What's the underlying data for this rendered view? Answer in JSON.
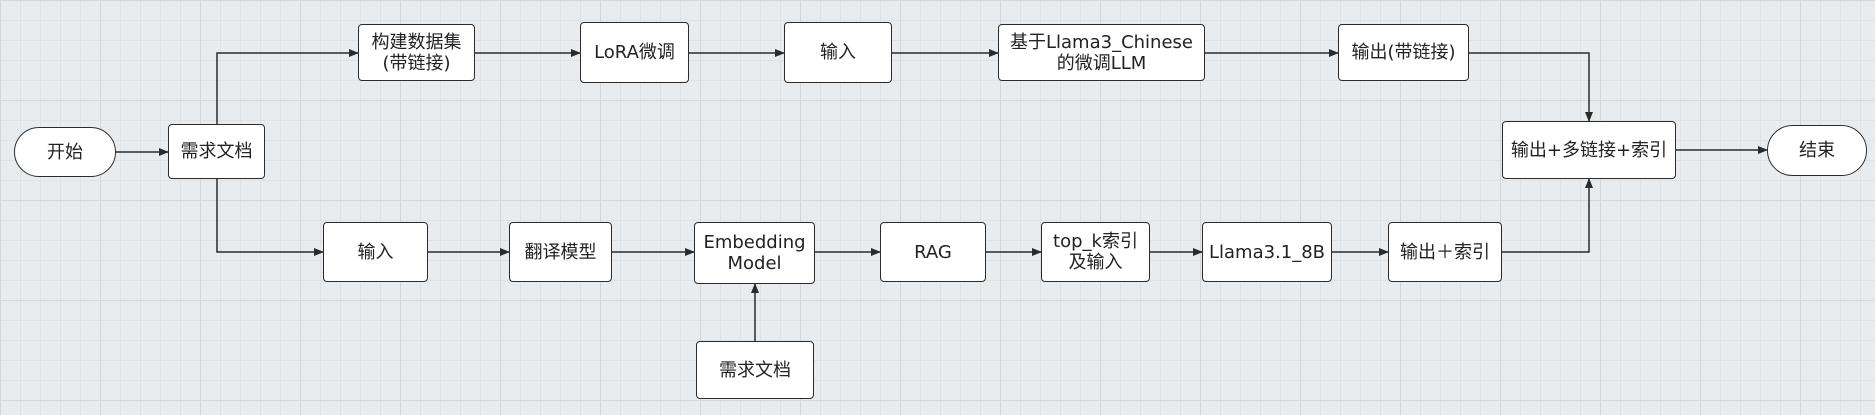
{
  "diagram": {
    "nodes": {
      "start": "开始",
      "req_doc_main": "需求文档",
      "build_dataset": "构建数据集\n(带链接)",
      "lora": "LoRA微调",
      "input_top": "输入",
      "llama3_chinese": "基于Llama3_Chinese\n的微调LLM",
      "output_link": "输出(带链接)",
      "output_multi": "输出+多链接+索引",
      "end": "结束",
      "input_bottom": "输入",
      "translate": "翻译模型",
      "embedding": "Embedding\nModel",
      "rag": "RAG",
      "topk": "top_k索引\n及输入",
      "llama31": "Llama3.1_8B",
      "output_index": "输出＋索引",
      "req_doc_bottom": "需求文档"
    },
    "edges": [
      [
        "start",
        "req_doc_main"
      ],
      [
        "req_doc_main",
        "build_dataset"
      ],
      [
        "build_dataset",
        "lora"
      ],
      [
        "lora",
        "input_top"
      ],
      [
        "input_top",
        "llama3_chinese"
      ],
      [
        "llama3_chinese",
        "output_link"
      ],
      [
        "output_link",
        "output_multi"
      ],
      [
        "req_doc_main",
        "input_bottom"
      ],
      [
        "input_bottom",
        "translate"
      ],
      [
        "translate",
        "embedding"
      ],
      [
        "embedding",
        "rag"
      ],
      [
        "rag",
        "topk"
      ],
      [
        "topk",
        "llama31"
      ],
      [
        "llama31",
        "output_index"
      ],
      [
        "output_index",
        "output_multi"
      ],
      [
        "req_doc_bottom",
        "embedding"
      ],
      [
        "output_multi",
        "end"
      ]
    ]
  }
}
